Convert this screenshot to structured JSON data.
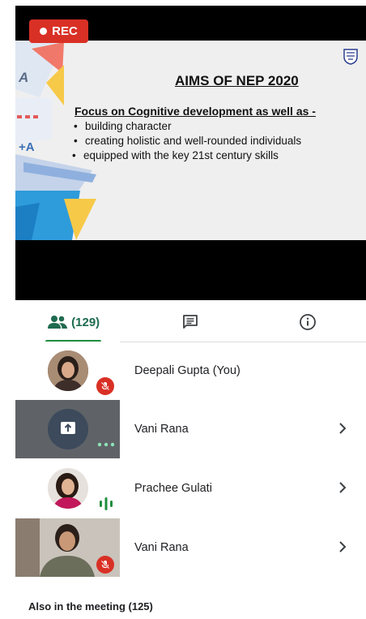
{
  "recording": {
    "label": "REC"
  },
  "slide": {
    "title": "AIMS OF NEP 2020",
    "subtitle": "Focus on Cognitive development as well as -",
    "bullets": [
      "building character",
      "creating holistic and well-rounded individuals",
      "equipped with the key 21st century skills"
    ],
    "decor_text": [
      "A",
      "+A"
    ]
  },
  "tabs": {
    "people_count": "(129)",
    "active": "people"
  },
  "participants": [
    {
      "name": "Deepali Gupta (You)",
      "mic": "muted"
    },
    {
      "name": "Vani Rana",
      "mic": "presenting"
    },
    {
      "name": "Prachee Gulati",
      "mic": "speaking"
    },
    {
      "name": "Vani Rana",
      "mic": "muted"
    }
  ],
  "also_in_meeting": "Also in the meeting (125)",
  "colors": {
    "accent_green": "#1e8e3e",
    "rec_red": "#d93025",
    "muted_red": "#d93025"
  }
}
